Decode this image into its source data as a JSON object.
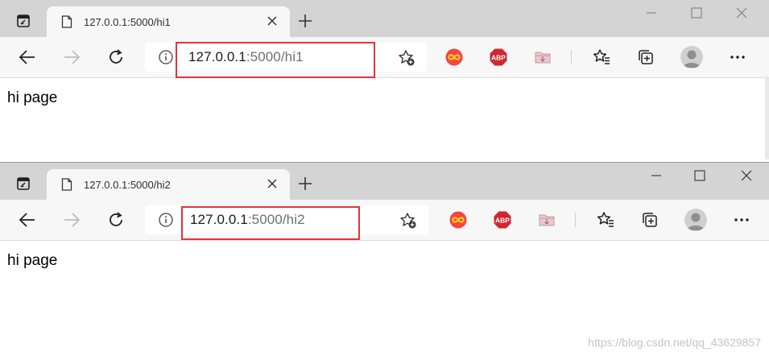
{
  "windows": [
    {
      "tab_title": "127.0.0.1:5000/hi1",
      "url_host": "127.0.0.1",
      "url_path": ":5000/hi1",
      "page_text": "hi page"
    },
    {
      "tab_title": "127.0.0.1:5000/hi2",
      "url_host": "127.0.0.1",
      "url_path": ":5000/hi2",
      "page_text": "hi page"
    }
  ],
  "extensions": {
    "adblock_label": "ABP"
  },
  "icons": [
    "tab-actions-icon",
    "document-icon",
    "close-icon",
    "plus-icon",
    "minimize-icon",
    "maximize-icon",
    "window-close-icon",
    "back-icon",
    "forward-icon",
    "refresh-icon",
    "info-icon",
    "add-favorite-icon",
    "infinity-extension-icon",
    "adblock-plus-icon",
    "folder-extension-icon",
    "favorites-icon",
    "collections-icon",
    "profile-avatar",
    "more-icon"
  ],
  "colors": {
    "highlight": "#e0343d",
    "tab_strip": "#d4d4d4",
    "toolbar": "#f7f7f7",
    "adblock_red": "#d3262e",
    "infinity_bg": "#f4463f",
    "infinity_fg": "#ffc52a"
  },
  "watermark": "https://blog.csdn.net/qq_43629857"
}
